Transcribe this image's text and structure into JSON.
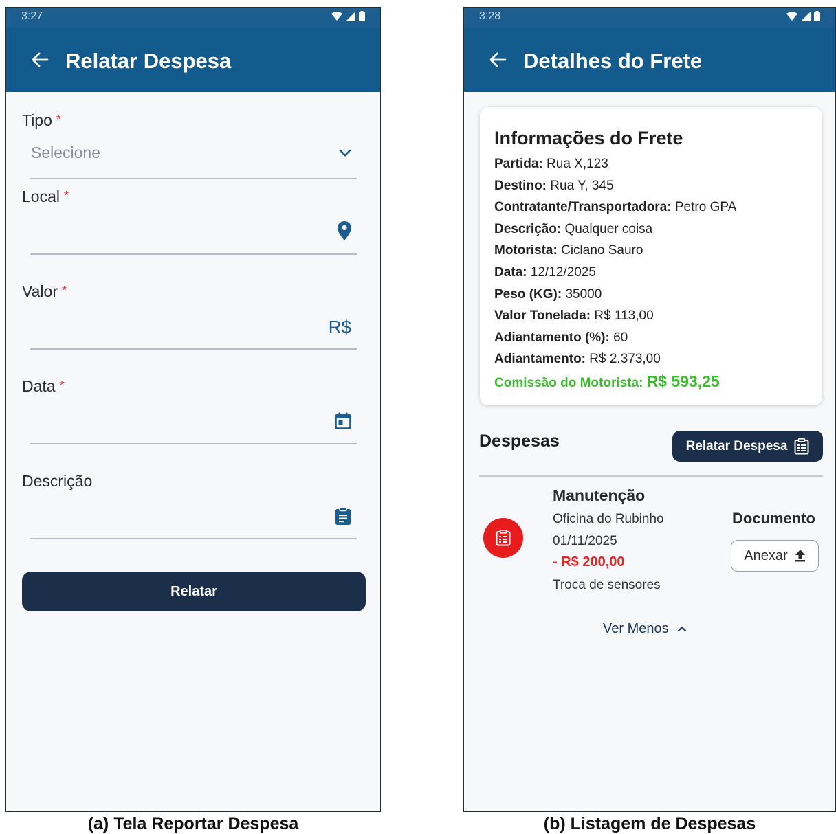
{
  "screen_a": {
    "time": "3:27",
    "title": "Relatar Despesa",
    "fields": {
      "tipo": {
        "label": "Tipo",
        "placeholder": "Selecione"
      },
      "local": {
        "label": "Local"
      },
      "valor": {
        "label": "Valor",
        "suffix": "R$"
      },
      "data": {
        "label": "Data"
      },
      "descricao": {
        "label": "Descrição"
      }
    },
    "required_mark": "*",
    "submit_label": "Relatar"
  },
  "screen_b": {
    "time": "3:28",
    "title": "Detalhes do Frete",
    "card_title": "Informações do Frete",
    "info": [
      {
        "label": "Partida:",
        "value": "Rua X,123"
      },
      {
        "label": "Destino:",
        "value": "Rua Y, 345"
      },
      {
        "label": "Contratante/Transportadora:",
        "value": "Petro GPA"
      },
      {
        "label": "Descrição:",
        "value": "Qualquer coisa"
      },
      {
        "label": "Motorista:",
        "value": "Ciclano Sauro"
      },
      {
        "label": "Data:",
        "value": "12/12/2025"
      },
      {
        "label": "Peso (KG):",
        "value": "35000"
      },
      {
        "label": "Valor Tonelada:",
        "value": "R$ 113,00"
      },
      {
        "label": "Adiantamento (%):",
        "value": "60"
      },
      {
        "label": "Adiantamento:",
        "value": "R$ 2.373,00"
      }
    ],
    "commission": {
      "label": "Comissão do Motorista:",
      "value": "R$ 593,25"
    },
    "expenses_title": "Despesas",
    "report_button": "Relatar Despesa",
    "expense": {
      "type": "Manutenção",
      "place": "Oficina do Rubinho",
      "date": "01/11/2025",
      "value": "- R$ 200,00",
      "description": "Troca de sensores"
    },
    "document_label": "Documento",
    "attach_button": "Anexar",
    "toggle_label": "Ver Menos"
  },
  "captions": {
    "a": "(a) Tela Reportar Despesa",
    "b": "(b) Listagem de Despesas"
  },
  "colors": {
    "appbar": "#145b8d",
    "button_dark": "#1b2f4a",
    "required": "#e53935",
    "commission": "#3dbb2f",
    "expense_red": "#e81c1c"
  },
  "icons": [
    "back-arrow-icon",
    "chevron-down-icon",
    "location-pin-icon",
    "calendar-icon",
    "clipboard-icon",
    "upload-icon",
    "chevron-up-icon",
    "wifi-icon",
    "signal-icon",
    "battery-icon"
  ]
}
